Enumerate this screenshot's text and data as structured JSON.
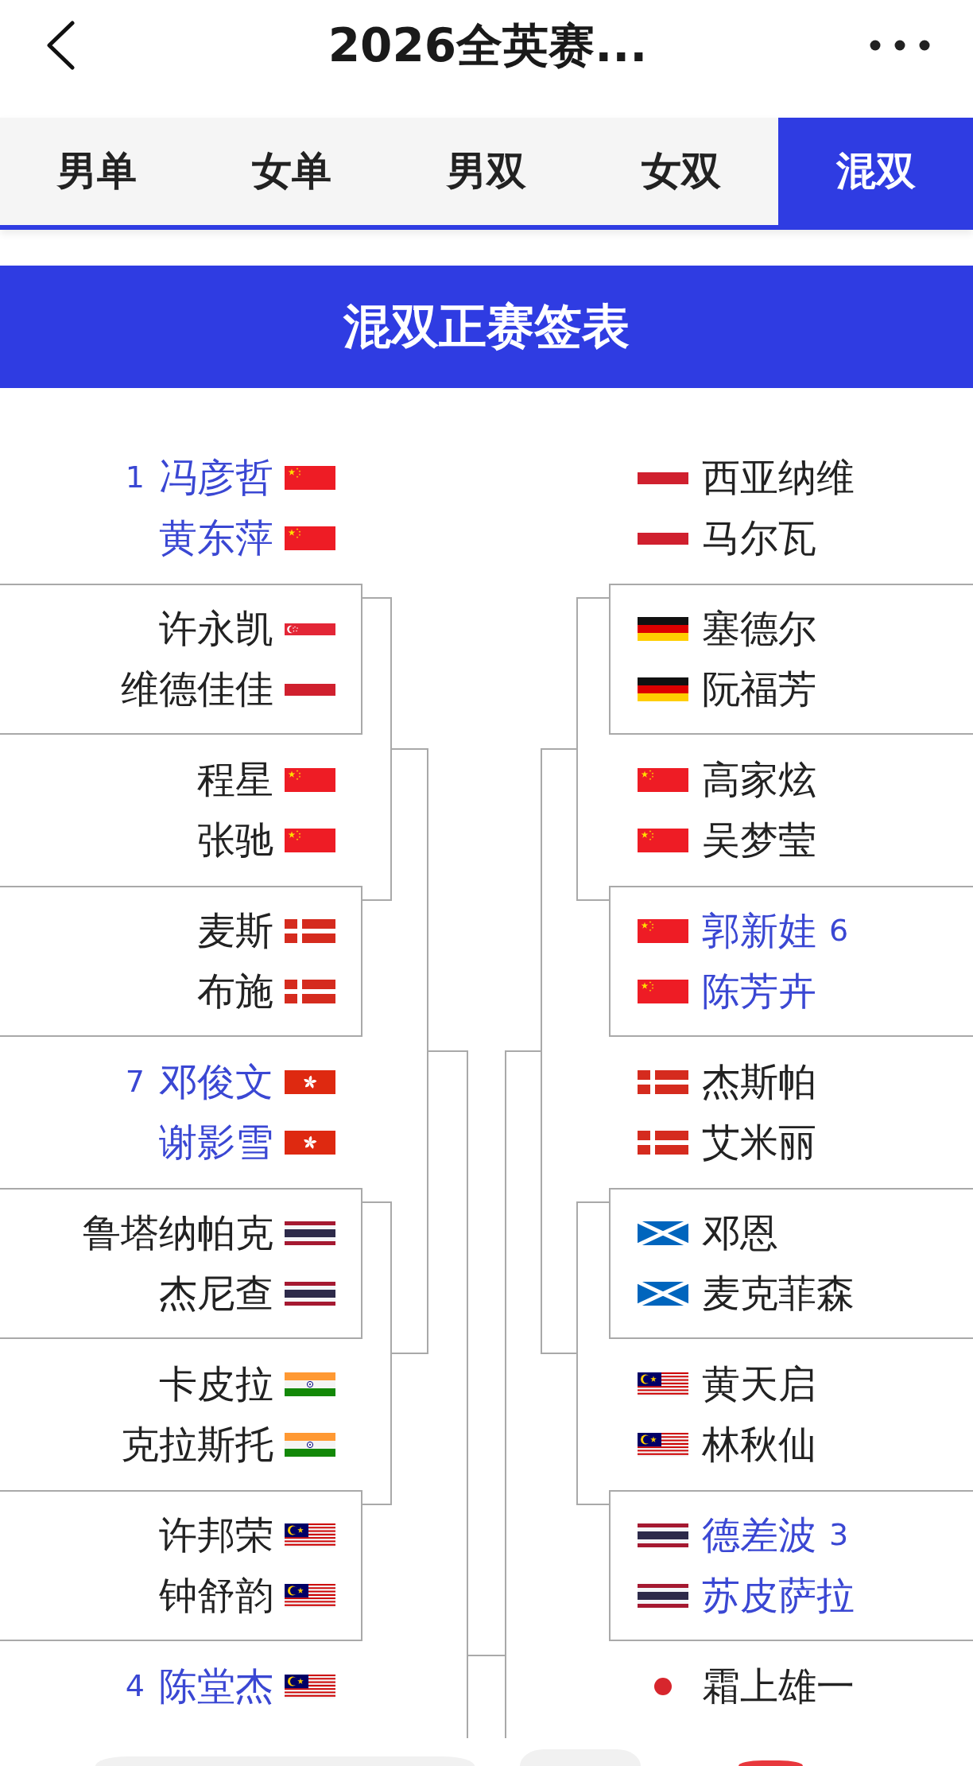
{
  "header": {
    "title": "2026全英赛..."
  },
  "tabs": [
    {
      "label": "男单",
      "selected": false
    },
    {
      "label": "女单",
      "selected": false
    },
    {
      "label": "男双",
      "selected": false
    },
    {
      "label": "女双",
      "selected": false
    },
    {
      "label": "混双",
      "selected": true
    }
  ],
  "banner": {
    "title": "混双正赛签表"
  },
  "bracket": {
    "left": [
      {
        "seed": "1",
        "players": [
          {
            "name": "冯彦哲",
            "kind": "chn"
          },
          {
            "name": "黄东萍",
            "kind": "chn"
          }
        ]
      },
      {
        "players": [
          {
            "name": "许永凯",
            "kind": "sgp"
          },
          {
            "name": "维德佳佳",
            "kind": "ina"
          }
        ]
      },
      {
        "players": [
          {
            "name": "程星",
            "kind": "chn"
          },
          {
            "name": "张驰",
            "kind": "chn"
          }
        ]
      },
      {
        "players": [
          {
            "name": "麦斯",
            "kind": "den"
          },
          {
            "name": "布施",
            "kind": "den"
          }
        ]
      },
      {
        "seed": "7",
        "players": [
          {
            "name": "邓俊文",
            "kind": "hkg"
          },
          {
            "name": "谢影雪",
            "kind": "hkg"
          }
        ]
      },
      {
        "players": [
          {
            "name": "鲁塔纳帕克",
            "kind": "tha"
          },
          {
            "name": "杰尼查",
            "kind": "tha"
          }
        ]
      },
      {
        "players": [
          {
            "name": "卡皮拉",
            "kind": "ind"
          },
          {
            "name": "克拉斯托",
            "kind": "ind"
          }
        ]
      },
      {
        "players": [
          {
            "name": "许邦荣",
            "kind": "mas"
          },
          {
            "name": "钟舒韵",
            "kind": "mas"
          }
        ]
      },
      {
        "seed": "4",
        "players": [
          {
            "name": "陈堂杰",
            "kind": "mas"
          }
        ]
      }
    ],
    "right": [
      {
        "players": [
          {
            "name": "西亚纳维",
            "kind": "ina"
          },
          {
            "name": "马尔瓦",
            "kind": "ina"
          }
        ]
      },
      {
        "players": [
          {
            "name": "塞德尔",
            "kind": "ger"
          },
          {
            "name": "阮福芳",
            "kind": "ger"
          }
        ]
      },
      {
        "players": [
          {
            "name": "高家炫",
            "kind": "chn"
          },
          {
            "name": "吴梦莹",
            "kind": "chn"
          }
        ]
      },
      {
        "seed": "6",
        "players": [
          {
            "name": "郭新娃",
            "kind": "chn"
          },
          {
            "name": "陈芳卉",
            "kind": "chn"
          }
        ]
      },
      {
        "players": [
          {
            "name": "杰斯帕",
            "kind": "den"
          },
          {
            "name": "艾米丽",
            "kind": "den"
          }
        ]
      },
      {
        "players": [
          {
            "name": "邓恩",
            "kind": "sco"
          },
          {
            "name": "麦克菲森",
            "kind": "sco"
          }
        ]
      },
      {
        "players": [
          {
            "name": "黄天启",
            "kind": "mas"
          },
          {
            "name": "林秋仙",
            "kind": "mas"
          }
        ]
      },
      {
        "seed": "3",
        "players": [
          {
            "name": "德差波",
            "kind": "tha"
          },
          {
            "name": "苏皮萨拉",
            "kind": "tha"
          }
        ]
      },
      {
        "players": [
          {
            "name": "霜上雄一",
            "kind": "jpn"
          }
        ]
      }
    ]
  }
}
